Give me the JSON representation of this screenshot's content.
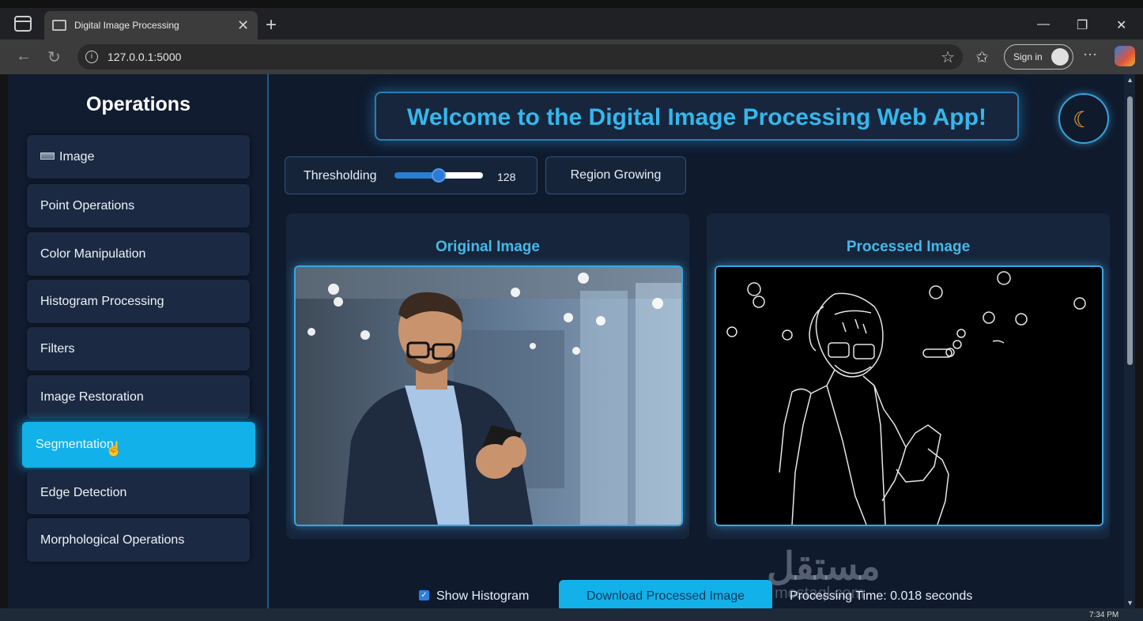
{
  "browser": {
    "tab_title": "Digital Image Processing",
    "url": "127.0.0.1:5000",
    "signin_label": "Sign in"
  },
  "sidebar": {
    "title": "Operations",
    "items": [
      {
        "label": "Image"
      },
      {
        "label": "Point Operations"
      },
      {
        "label": "Color Manipulation"
      },
      {
        "label": "Histogram Processing"
      },
      {
        "label": "Filters"
      },
      {
        "label": "Image Restoration"
      },
      {
        "label": "Segmentation",
        "active": true
      },
      {
        "label": "Edge Detection"
      },
      {
        "label": "Morphological Operations"
      }
    ]
  },
  "header": {
    "welcome": "Welcome to the Digital Image Processing Web App!",
    "theme_icon": "moon-icon"
  },
  "controls": {
    "thresholding_label": "Thresholding",
    "threshold_value": "128",
    "threshold_fraction": 0.5,
    "region_growing_label": "Region Growing"
  },
  "panels": {
    "original_title": "Original Image",
    "processed_title": "Processed Image"
  },
  "footer": {
    "show_histogram_label": "Show Histogram",
    "download_label": "Download Processed Image",
    "processing_time": "Processing Time: 0.018 seconds"
  },
  "watermark": {
    "main": "مستقل",
    "sub": "mostaql.com"
  },
  "taskbar": {
    "clock": "7:34 PM"
  },
  "colors": {
    "accent": "#13b1ea",
    "title_blue": "#35b7ec",
    "background": "#0f1a2d"
  }
}
